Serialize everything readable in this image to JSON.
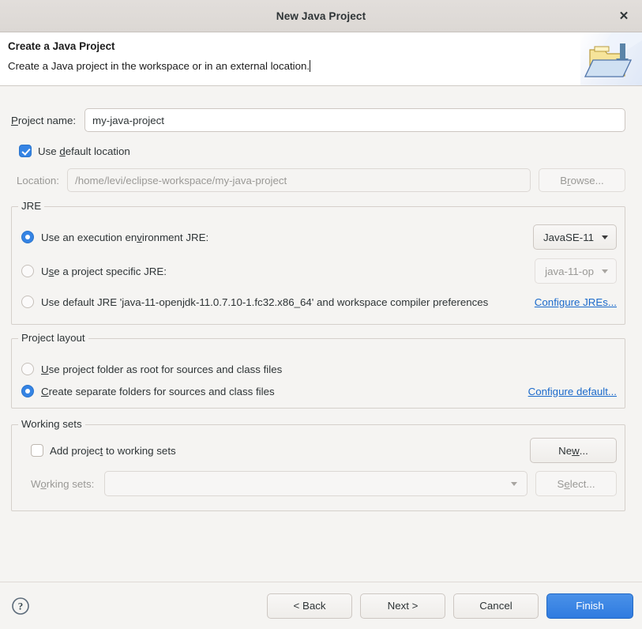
{
  "titlebar": {
    "title": "New Java Project",
    "close_label": "✕"
  },
  "header": {
    "title": "Create a Java Project",
    "description": "Create a Java project in the workspace or in an external location.",
    "icon": "java-project-folder-icon"
  },
  "project_name": {
    "label": "Project name:",
    "value": "my-java-project",
    "placeholder": ""
  },
  "use_default_location": {
    "label": "Use default location",
    "checked": true
  },
  "location": {
    "label": "Location:",
    "value": "/home/levi/eclipse-workspace/my-java-project",
    "enabled": false,
    "browse_label": "Browse..."
  },
  "jre": {
    "group_title": "JRE",
    "options": [
      {
        "label": "Use an execution environment JRE:",
        "selected": true,
        "combo_value": "JavaSE-11",
        "combo_enabled": true
      },
      {
        "label": "Use a project specific JRE:",
        "selected": false,
        "combo_value": "java-11-op",
        "combo_enabled": false
      },
      {
        "label": "Use default JRE 'java-11-openjdk-11.0.7.10-1.fc32.x86_64' and workspace compiler preferences",
        "selected": false
      }
    ],
    "configure_link": "Configure JREs..."
  },
  "project_layout": {
    "group_title": "Project layout",
    "options": [
      {
        "label": "Use project folder as root for sources and class files",
        "selected": false
      },
      {
        "label": "Create separate folders for sources and class files",
        "selected": true
      }
    ],
    "configure_link": "Configure default..."
  },
  "working_sets": {
    "group_title": "Working sets",
    "add_checkbox_label": "Add project to working sets",
    "add_checked": false,
    "new_button": "New...",
    "combo_label": "Working sets:",
    "combo_value": "",
    "select_button": "Select..."
  },
  "footer": {
    "help_icon": "help-circle-icon",
    "back": "< Back",
    "next": "Next >",
    "cancel": "Cancel",
    "finish": "Finish"
  },
  "colors": {
    "accent": "#3584e4",
    "primary_button": "#2f7be0",
    "link": "#1b6acb",
    "window_bg": "#f5f4f2",
    "titlebar_bg": "#dcd8d4",
    "banner_bg": "#ffffff"
  }
}
